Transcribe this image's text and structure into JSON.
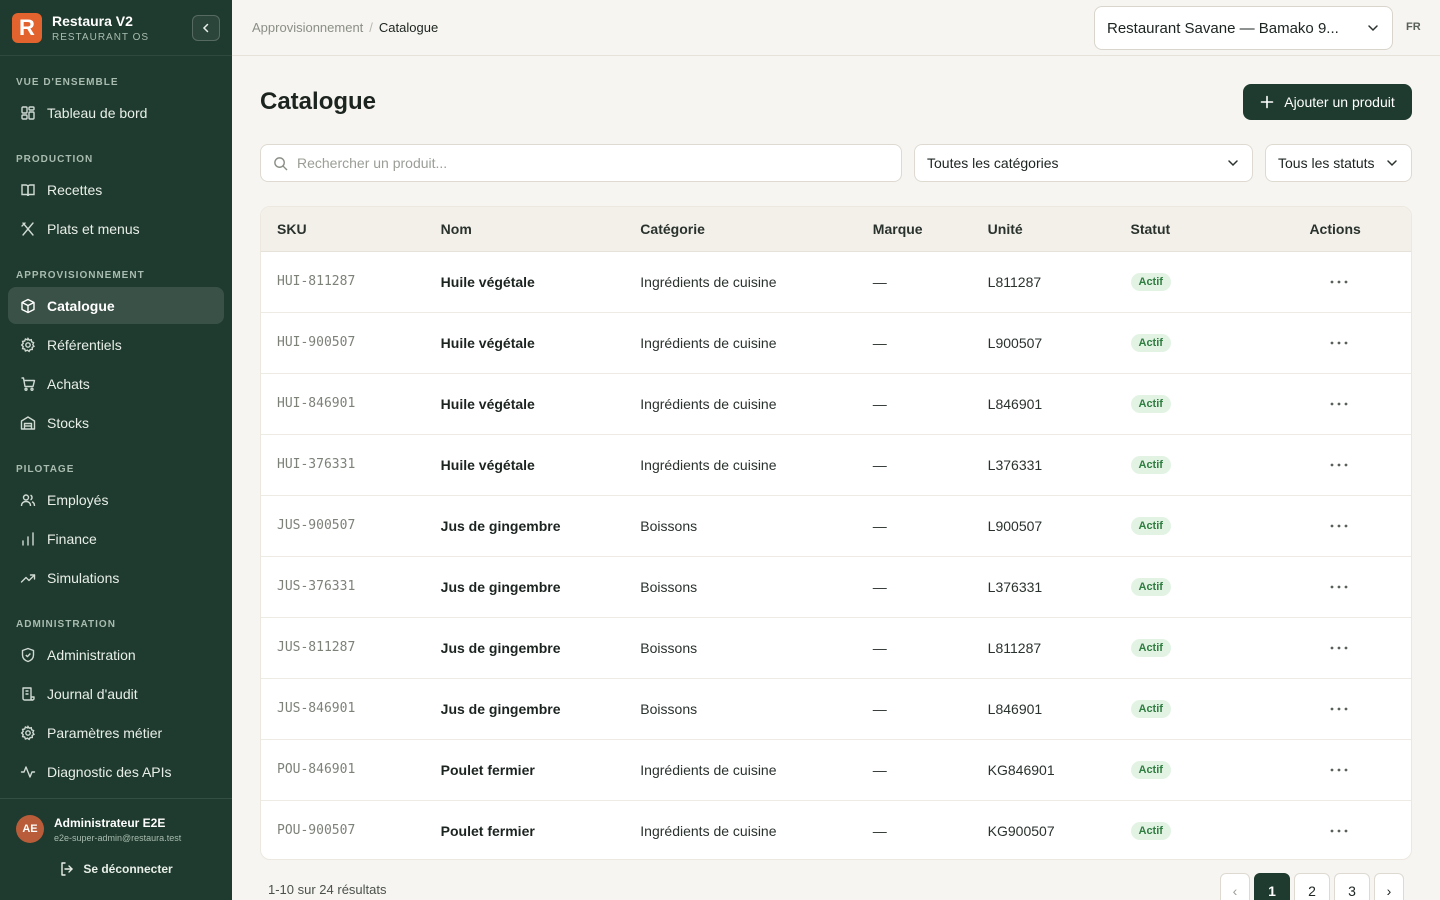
{
  "brand": {
    "name": "Restaura V2",
    "subtitle": "RESTAURANT OS",
    "logo_letter": "R"
  },
  "sidebar": {
    "sections": [
      {
        "label": "VUE D'ENSEMBLE",
        "items": [
          {
            "label": "Tableau de bord",
            "icon": "grid-icon"
          }
        ]
      },
      {
        "label": "PRODUCTION",
        "items": [
          {
            "label": "Recettes",
            "icon": "book-icon"
          },
          {
            "label": "Plats et menus",
            "icon": "utensils-icon"
          }
        ]
      },
      {
        "label": "APPROVISIONNEMENT",
        "items": [
          {
            "label": "Catalogue",
            "icon": "box-icon",
            "active": true
          },
          {
            "label": "Référentiels",
            "icon": "gear-icon"
          },
          {
            "label": "Achats",
            "icon": "cart-icon"
          },
          {
            "label": "Stocks",
            "icon": "warehouse-icon"
          }
        ]
      },
      {
        "label": "PILOTAGE",
        "items": [
          {
            "label": "Employés",
            "icon": "users-icon"
          },
          {
            "label": "Finance",
            "icon": "bar-chart-icon"
          },
          {
            "label": "Simulations",
            "icon": "trend-icon"
          }
        ]
      },
      {
        "label": "ADMINISTRATION",
        "items": [
          {
            "label": "Administration",
            "icon": "shield-icon"
          },
          {
            "label": "Journal d'audit",
            "icon": "scroll-icon"
          },
          {
            "label": "Paramètres métier",
            "icon": "gear-icon"
          },
          {
            "label": "Diagnostic des APIs",
            "icon": "pulse-icon"
          }
        ]
      }
    ]
  },
  "user": {
    "initials": "AE",
    "name": "Administrateur E2E",
    "email": "e2e-super-admin@restaura.test",
    "logout_label": "Se déconnecter"
  },
  "header": {
    "breadcrumb": [
      "Approvisionnement",
      "Catalogue"
    ],
    "restaurant": "Restaurant Savane — Bamako 9...",
    "lang": "FR"
  },
  "main": {
    "title": "Catalogue",
    "add_button": "Ajouter un produit",
    "search_placeholder": "Rechercher un produit...",
    "category_filter": "Toutes les catégories",
    "status_filter": "Tous les statuts"
  },
  "table": {
    "columns": [
      "SKU",
      "Nom",
      "Catégorie",
      "Marque",
      "Unité",
      "Statut",
      "Actions"
    ],
    "rows": [
      {
        "sku": "HUI-811287",
        "name": "Huile végétale",
        "category": "Ingrédients de cuisine",
        "brand": "—",
        "unit": "L811287",
        "status": "Actif"
      },
      {
        "sku": "HUI-900507",
        "name": "Huile végétale",
        "category": "Ingrédients de cuisine",
        "brand": "—",
        "unit": "L900507",
        "status": "Actif"
      },
      {
        "sku": "HUI-846901",
        "name": "Huile végétale",
        "category": "Ingrédients de cuisine",
        "brand": "—",
        "unit": "L846901",
        "status": "Actif"
      },
      {
        "sku": "HUI-376331",
        "name": "Huile végétale",
        "category": "Ingrédients de cuisine",
        "brand": "—",
        "unit": "L376331",
        "status": "Actif"
      },
      {
        "sku": "JUS-900507",
        "name": "Jus de gingembre",
        "category": "Boissons",
        "brand": "—",
        "unit": "L900507",
        "status": "Actif"
      },
      {
        "sku": "JUS-376331",
        "name": "Jus de gingembre",
        "category": "Boissons",
        "brand": "—",
        "unit": "L376331",
        "status": "Actif"
      },
      {
        "sku": "JUS-811287",
        "name": "Jus de gingembre",
        "category": "Boissons",
        "brand": "—",
        "unit": "L811287",
        "status": "Actif"
      },
      {
        "sku": "JUS-846901",
        "name": "Jus de gingembre",
        "category": "Boissons",
        "brand": "—",
        "unit": "L846901",
        "status": "Actif"
      },
      {
        "sku": "POU-846901",
        "name": "Poulet fermier",
        "category": "Ingrédients de cuisine",
        "brand": "—",
        "unit": "KG846901",
        "status": "Actif"
      },
      {
        "sku": "POU-900507",
        "name": "Poulet fermier",
        "category": "Ingrédients de cuisine",
        "brand": "—",
        "unit": "KG900507",
        "status": "Actif"
      }
    ]
  },
  "pagination": {
    "summary": "1-10 sur 24 résultats",
    "prev": "‹",
    "pages": [
      "1",
      "2",
      "3"
    ],
    "next": "›",
    "current": "1"
  },
  "colors": {
    "sidebar_bg": "#1f3a2e",
    "accent": "#1f3a2e",
    "logo": "#e2632d",
    "badge_bg": "#e2f3e4",
    "badge_text": "#2f7d40"
  }
}
